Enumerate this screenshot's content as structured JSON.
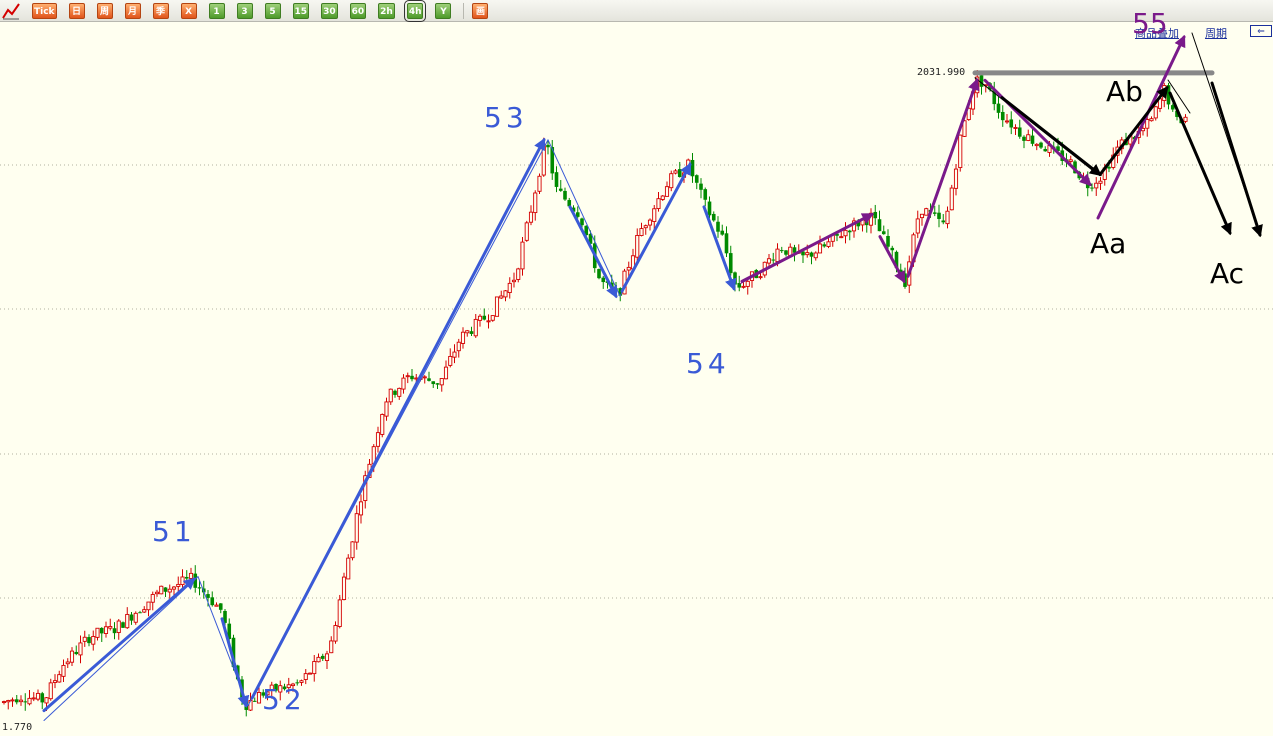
{
  "toolbar": {
    "buttons": [
      {
        "label": "Tick",
        "style": "orange"
      },
      {
        "label": "日",
        "style": "orange"
      },
      {
        "label": "周",
        "style": "orange"
      },
      {
        "label": "月",
        "style": "orange"
      },
      {
        "label": "季",
        "style": "orange"
      },
      {
        "label": "X",
        "style": "orange"
      },
      {
        "label": "1",
        "style": "green"
      },
      {
        "label": "3",
        "style": "green"
      },
      {
        "label": "5",
        "style": "green"
      },
      {
        "label": "15",
        "style": "green"
      },
      {
        "label": "30",
        "style": "green"
      },
      {
        "label": "60",
        "style": "green"
      },
      {
        "label": "2h",
        "style": "green"
      },
      {
        "label": "4h",
        "style": "green",
        "selected": true
      },
      {
        "label": "Y",
        "style": "green"
      },
      {
        "label": "画",
        "style": "orange"
      }
    ]
  },
  "header_links": {
    "overlay": "商品叠加",
    "period": "周期",
    "back": "⇐"
  },
  "price_labels": {
    "high": "2031.990",
    "low": "1.770"
  },
  "colors": {
    "background": "#fffff0",
    "up_candle": "#d40000",
    "down_candle": "#008a00",
    "blue_wave": "#3a5ad6",
    "purple_wave": "#7a1a8a",
    "black_wave": "#000000",
    "resistance": "#888888"
  },
  "wave_labels": [
    {
      "text": "51",
      "color": "blue"
    },
    {
      "text": "52",
      "color": "blue"
    },
    {
      "text": "53",
      "color": "blue"
    },
    {
      "text": "54",
      "color": "blue"
    },
    {
      "text": "55",
      "color": "purple"
    },
    {
      "text": "Aa",
      "color": "black"
    },
    {
      "text": "Ab",
      "color": "black"
    },
    {
      "text": "Ac",
      "color": "black"
    }
  ],
  "chart_data": {
    "type": "candlestick",
    "interval": "4h",
    "y_range": [
      1770,
      2040
    ],
    "price_high": 2031.99,
    "price_low": 1770,
    "wave_points": [
      {
        "label": "51-start",
        "price": 1771
      },
      {
        "label": "51",
        "price": 1828
      },
      {
        "label": "52",
        "price": 1777
      },
      {
        "label": "53",
        "price": 2005
      },
      {
        "label": "54",
        "price": 1945
      },
      {
        "label": "55",
        "price": 2031.99
      },
      {
        "label": "Aa",
        "price": 1987
      },
      {
        "label": "Ab",
        "price": 2026
      }
    ]
  }
}
